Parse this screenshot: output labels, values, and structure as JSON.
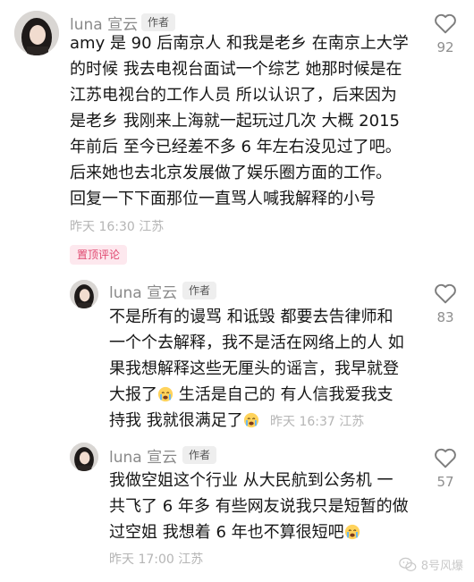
{
  "comments": [
    {
      "author": "luna 宣云",
      "badge": "作者",
      "lines": [
        "amy 是 90 后南京人 和我是老乡 在南京上大学",
        "的时候 我去电视台面试一个综艺 她那时候是在",
        "江苏电视台的工作人员 所以认识了，后来因为",
        "是老乡 我刚来上海就一起玩过几次 大概 2015",
        "年前后 至今已经差不多 6 年左右没见过了吧。",
        "后来她也去北京发展做了娱乐圈方面的工作。",
        "回复一下下面那位一直骂人喊我解释的小号"
      ],
      "meta": "昨天 16:30 江苏",
      "likes": "92",
      "pinned_label": "置顶评论"
    },
    {
      "author": "luna 宣云",
      "badge": "作者",
      "lines": [
        "不是所有的谩骂 和诋毁 都要去告律师和",
        "一个个去解释，我不是活在网络上的人 如",
        "果我想解释这些无厘头的谣言，我早就登",
        "大报了",
        " 生活是自己的 有人信我爱我支",
        "持我 我就很满足了"
      ],
      "meta": "昨天 16:37 江苏",
      "likes": "83"
    },
    {
      "author": "luna 宣云",
      "badge": "作者",
      "lines": [
        "我做空姐这个行业 从大民航到公务机 一",
        "共飞了 6 年多 有些网友说我只是短暂的做",
        "过空姐 我想着 6 年也不算很短吧"
      ],
      "meta": "昨天 17:00 江苏",
      "likes": "57"
    }
  ],
  "icons": {
    "like": "heart-outline-icon",
    "emoji": "crying-face-emoji",
    "watermark": "wechat-icon"
  },
  "watermark_text": "8号风爆",
  "colors": {
    "pinned_text": "#e0476f",
    "pinned_bg": "#fde8ee",
    "meta_gray": "#b5b5b5"
  }
}
